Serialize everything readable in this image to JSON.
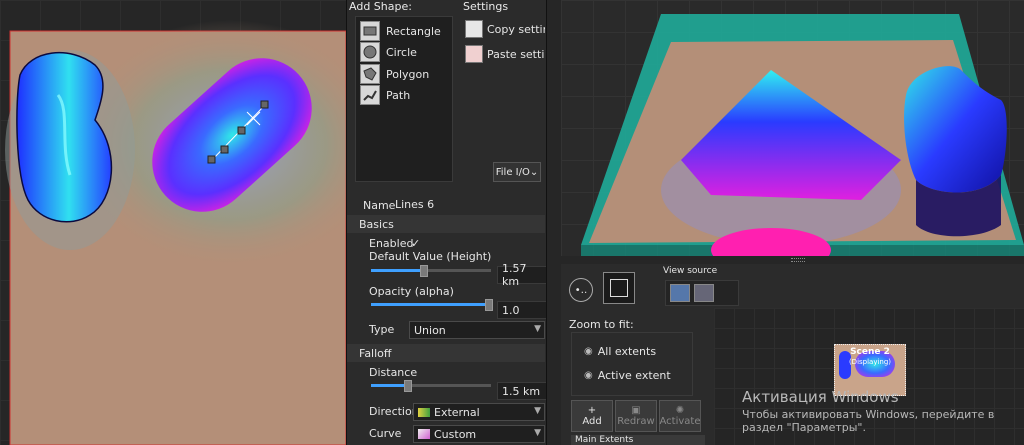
{
  "add_shape": {
    "title": "Add Shape:",
    "items": [
      {
        "label": "Rectangle",
        "icon": "rectangle-icon"
      },
      {
        "label": "Circle",
        "icon": "circle-icon"
      },
      {
        "label": "Polygon",
        "icon": "polygon-icon"
      },
      {
        "label": "Path",
        "icon": "path-icon"
      }
    ]
  },
  "settings": {
    "title": "Settings",
    "copy_label": "Copy setting",
    "paste_label": "Paste settin",
    "file_io_label": "File I/O"
  },
  "properties": {
    "name_label": "Name",
    "name_value": "Lines 6",
    "basics_header": "Basics",
    "enabled_label": "Enabled",
    "enabled_check": "✓",
    "default_value_label": "Default Value (Height)",
    "default_value": "1.57 km",
    "default_value_level": 0.43,
    "opacity_label": "Opacity (alpha)",
    "opacity_value": "1.0",
    "opacity_level": 1.0,
    "type_label": "Type",
    "type_value": "Union",
    "falloff_header": "Falloff",
    "distance_label": "Distance",
    "distance_value": "1.5 km",
    "distance_level": 0.3,
    "direction_label": "Direction",
    "direction_value": "External",
    "curve_label": "Curve",
    "curve_value": "Custom"
  },
  "view_source": {
    "title": "View source",
    "zoom_label": "Zoom to fit:",
    "all_extents": "All extents",
    "active_extent": "Active extent",
    "add_label": "Add",
    "add_icon_text": "+",
    "redraw_label": "Redraw",
    "activate_label": "Activate",
    "main_extents": "Main Extents"
  },
  "scene": {
    "title": "Scene 2",
    "status": "(Displaying)"
  },
  "activation": {
    "title": "Активация Windows",
    "line1": "Чтобы активировать Windows, перейдите в",
    "line2": "раздел \"Параметры\"."
  },
  "colors": {
    "accent": "#3fa0ff",
    "terrain": "#b48f78",
    "blue": "#2a3bff",
    "magenta": "#e020e0",
    "cyan": "#30e8e8",
    "teal": "#1fb3a0"
  }
}
